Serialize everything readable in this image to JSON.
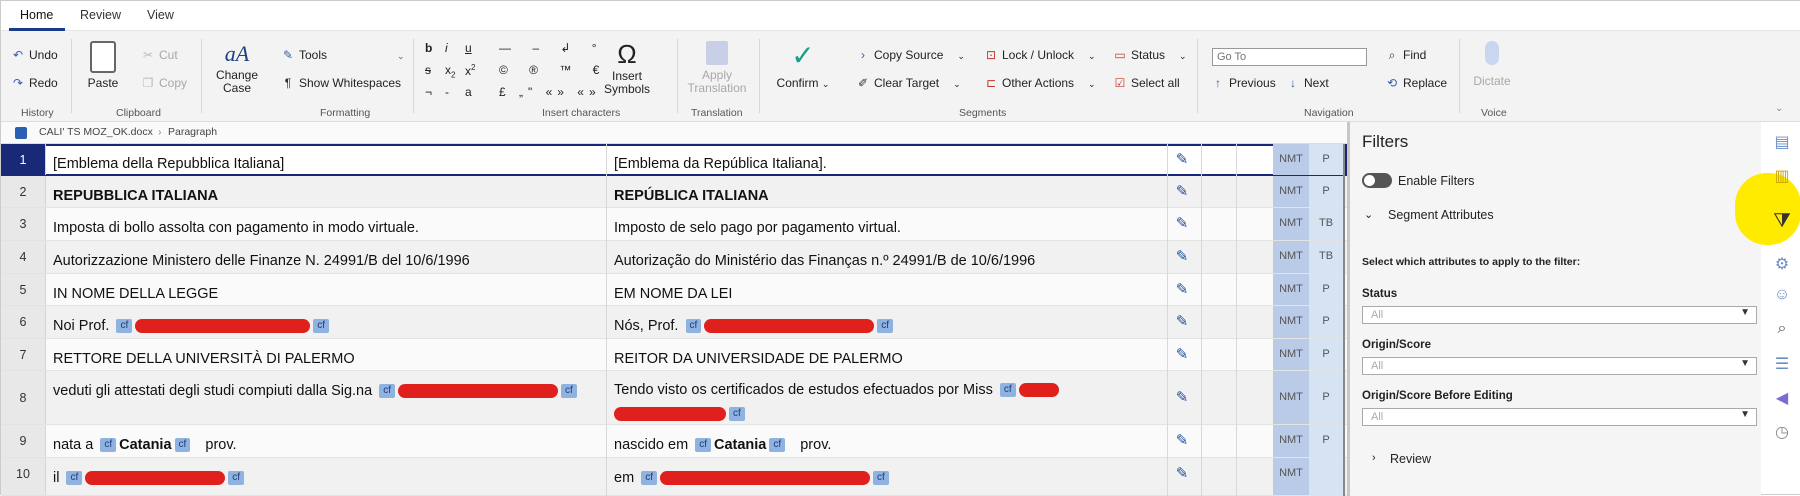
{
  "tabs": [
    "Home",
    "Review",
    "View"
  ],
  "ribbon": {
    "history": {
      "undo": "Undo",
      "redo": "Redo",
      "label": "History"
    },
    "clipboard": {
      "paste": "Paste",
      "cut": "Cut",
      "copy": "Copy",
      "label": "Clipboard"
    },
    "formatting": {
      "change_case": "Change Case",
      "tools": "Tools",
      "show_whitespaces": "Show Whitespaces",
      "label": "Formatting"
    },
    "insert_chars": {
      "label": "Insert characters",
      "insert_symbols": "Insert Symbols"
    },
    "translation": {
      "apply": "Apply Translation",
      "label": "Translation"
    },
    "segments": {
      "confirm": "Confirm",
      "copy_source": "Copy Source",
      "clear_target": "Clear Target",
      "lock_unlock": "Lock / Unlock",
      "other_actions": "Other Actions",
      "status": "Status",
      "select_all": "Select all",
      "label": "Segments"
    },
    "navigation": {
      "goto_placeholder": "Go To",
      "previous": "Previous",
      "next": "Next",
      "find": "Find",
      "replace": "Replace",
      "label": "Navigation"
    },
    "voice": {
      "dictate": "Dictate",
      "label": "Voice"
    }
  },
  "breadcrumb": {
    "file": "CALI' TS MOZ_OK.docx",
    "section": "Paragraph"
  },
  "segments": [
    {
      "n": "1",
      "source": "[Emblema della Repubblica Italiana]",
      "target": "[Emblema da República Italiana].",
      "origin": "NMT",
      "status": "P"
    },
    {
      "n": "2",
      "source": "REPUBBLICA ITALIANA",
      "target": "REPÚBLICA ITALIANA",
      "origin": "NMT",
      "status": "P"
    },
    {
      "n": "3",
      "source": "Imposta di bollo assolta con pagamento in modo virtuale.",
      "target": "Imposto de selo pago por pagamento virtual.",
      "origin": "NMT",
      "status": "TB"
    },
    {
      "n": "4",
      "source": "Autorizzazione Ministero delle Finanze N. 24991/B del 10/6/1996",
      "target": "Autorização do Ministério das Finanças n.º 24991/B de 10/6/1996",
      "origin": "NMT",
      "status": "TB"
    },
    {
      "n": "5",
      "source": "IN NOME DELLA LEGGE",
      "target": "EM NOME DA LEI",
      "origin": "NMT",
      "status": "P"
    },
    {
      "n": "6",
      "source": "Noi Prof.",
      "target": "Nós, Prof.",
      "origin": "NMT",
      "status": "P"
    },
    {
      "n": "7",
      "source": "RETTORE DELLA UNIVERSITÀ DI PALERMO",
      "target": "REITOR DA UNIVERSIDADE DE PALERMO",
      "origin": "NMT",
      "status": "P"
    },
    {
      "n": "8",
      "source": "veduti gli attestati degli studi compiuti dalla Sig.na",
      "target": "Tendo visto os certificados de estudos efectuados por Miss",
      "origin": "NMT",
      "status": "P"
    },
    {
      "n": "9",
      "source": "nata a",
      "source_bold": "Catania",
      "source_end": "prov.",
      "target": "nascido em",
      "target_bold": "Catania",
      "target_end": "prov.",
      "origin": "NMT",
      "status": "P"
    },
    {
      "n": "10",
      "source": "il",
      "target": "em",
      "origin": "NMT",
      "status": ""
    }
  ],
  "tag_label": "cf",
  "filters": {
    "title": "Filters",
    "enable": "Enable Filters",
    "segment_attributes": "Segment Attributes",
    "instruction": "Select which attributes to apply to the filter:",
    "status_label": "Status",
    "status_value": "All",
    "origin_label": "Origin/Score",
    "origin_value": "All",
    "origin_before_label": "Origin/Score Before Editing",
    "origin_before_value": "All",
    "review": "Review"
  },
  "colors": {
    "accent": "#1a2878",
    "highlight": "#ffeb00",
    "nmt": "#b9cbe6",
    "redaction": "#e0201c"
  }
}
